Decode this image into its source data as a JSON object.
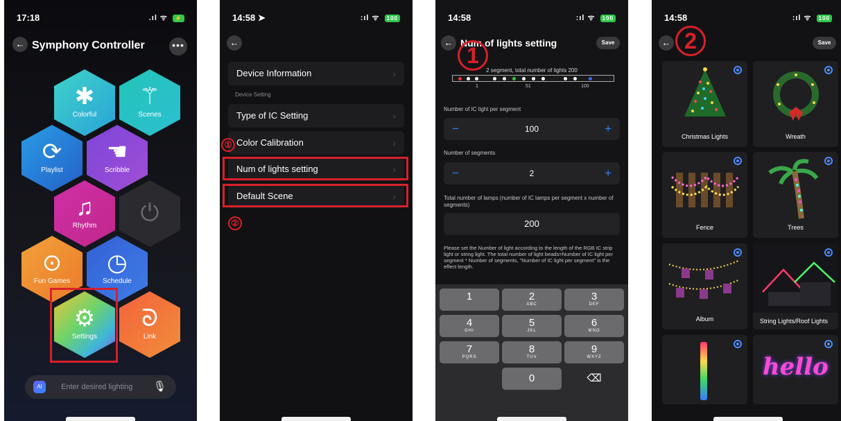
{
  "phone1": {
    "time": "17:18",
    "title": "Symphony Controller",
    "hexes": [
      {
        "label": "Colorful",
        "icon": "asterisk-icon"
      },
      {
        "label": "Scenes",
        "icon": "magic-wand-icon"
      },
      {
        "label": "Playlist",
        "icon": "refresh-icon"
      },
      {
        "label": "Scribble",
        "icon": "hand-touch-icon"
      },
      {
        "label": "Rhythm",
        "icon": "music-icon"
      },
      {
        "label": "",
        "icon": "power-icon"
      },
      {
        "label": "Fun Games",
        "icon": "gamepad-icon"
      },
      {
        "label": "Schedule",
        "icon": "clock-icon"
      },
      {
        "label": "Settings",
        "icon": "gear-icon"
      },
      {
        "label": "Link",
        "icon": "link-icon"
      }
    ],
    "ai_badge": "AI",
    "input_placeholder": "Enter desired lighting"
  },
  "phone2": {
    "time": "14:58",
    "items": [
      "Device Information",
      "Type of IC Setting",
      "Color Calibration",
      "Num of lights setting",
      "Default Scene"
    ],
    "section_header": "Device Setting",
    "markers": [
      "①",
      "②"
    ]
  },
  "phone3": {
    "time": "14:58",
    "title": "Num of lights setting",
    "save_label": "Save",
    "marker": "1",
    "segment_caption": "2 segment,  total number of lights 200",
    "ticks": [
      "1",
      "51",
      "100"
    ],
    "per_segment_label": "Number of IC light per segment",
    "per_segment_value": "100",
    "segments_label": "Number of segments",
    "segments_value": "2",
    "total_label": "Total number of lamps (number of IC lamps per segment x number of segments)",
    "total_value": "200",
    "note": "Please set the Number of light according to the length of the RGB IC strip light or string light. The total number of light beads=Number of IC light per segment  *  Number of segments, \"Number of IC light per segment\" is the effect length.",
    "keys": [
      {
        "n": "1",
        "l": ""
      },
      {
        "n": "2",
        "l": "ABC"
      },
      {
        "n": "3",
        "l": "DEF"
      },
      {
        "n": "4",
        "l": "GHI"
      },
      {
        "n": "5",
        "l": "JKL"
      },
      {
        "n": "6",
        "l": "MNO"
      },
      {
        "n": "7",
        "l": "PQRS"
      },
      {
        "n": "8",
        "l": "TUV"
      },
      {
        "n": "9",
        "l": "WXYZ"
      },
      {
        "n": "0",
        "l": ""
      },
      {
        "n": "⌫",
        "l": ""
      }
    ]
  },
  "phone4": {
    "time": "14:58",
    "save_label": "Save",
    "marker": "2",
    "scenes": [
      "Christmas Lights",
      "Wreath",
      "Fence",
      "Trees",
      "Album",
      "String Lights/Roof Lights",
      "",
      "hello"
    ]
  },
  "colors": {
    "accent_red": "#d8202a",
    "accent_blue": "#2f83ff"
  }
}
